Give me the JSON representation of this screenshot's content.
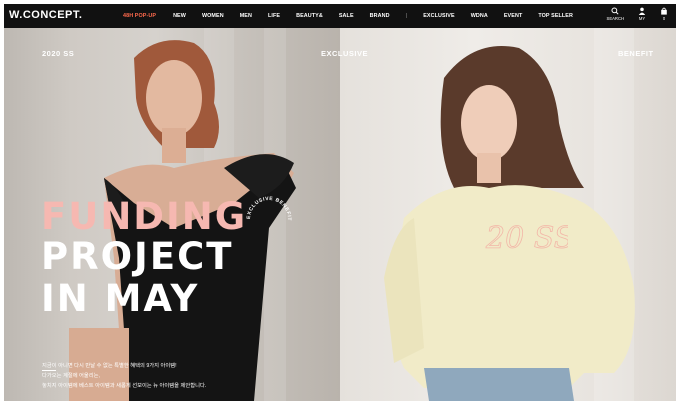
{
  "brand": {
    "logo": "W.CONCEPT."
  },
  "nav": {
    "items": [
      {
        "label": "48H POP-UP"
      },
      {
        "label": "NEW"
      },
      {
        "label": "WOMEN"
      },
      {
        "label": "MEN"
      },
      {
        "label": "LIFE"
      },
      {
        "label": "BEAUTY&"
      },
      {
        "label": "SALE"
      },
      {
        "label": "BRAND"
      },
      {
        "label": "|"
      },
      {
        "label": "EXCLUSIVE"
      },
      {
        "label": "WDNA"
      },
      {
        "label": "EVENT"
      },
      {
        "label": "TOP SELLER"
      }
    ],
    "utility": [
      {
        "label": "SEARCH",
        "icon": "search-icon"
      },
      {
        "label": "MY",
        "icon": "user-icon"
      },
      {
        "label": "0",
        "icon": "bag-icon"
      }
    ],
    "hot_color": "#ff6a4d"
  },
  "hero": {
    "season": "2020 SS",
    "exclusive": "EXCLUSIVE",
    "benefit": "BENEFIT",
    "headline": [
      "FUNDING",
      "PROJECT",
      "IN MAY"
    ],
    "headline_accent": "#f6b8b1",
    "description": [
      "지금이 아니면 다시 만날 수 없는 특별한 혜택의 9가지 아이템!",
      "다가오는 계절에 어울리는,",
      "놓치지 아이템에 베스트 아이템과 새롭게 선보이는 뉴 아이템을 제안합니다."
    ],
    "badge_text": "EXCLUSIVE BENEFIT",
    "script_text": "20 SS"
  }
}
